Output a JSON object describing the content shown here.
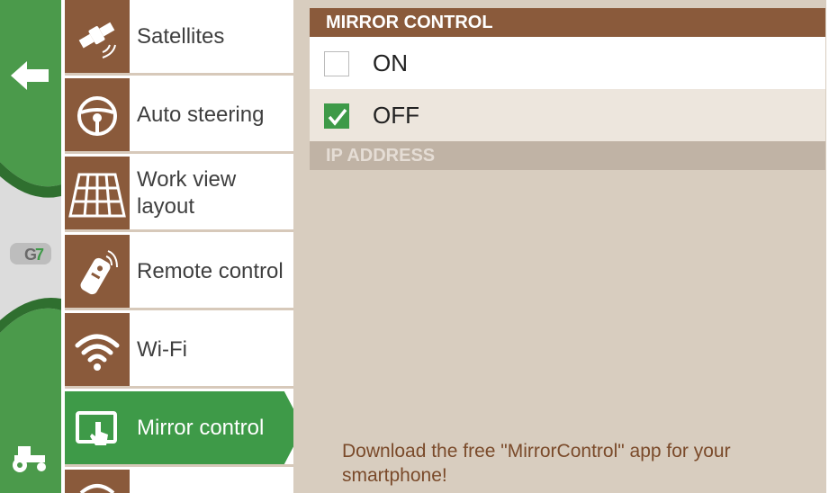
{
  "colors": {
    "rail_green": "#4b9a4b",
    "icon_brown": "#8a5a3b",
    "active_green": "#3e9a48",
    "panel_beige": "#d8cdbf",
    "note_brown": "#7a4a2a"
  },
  "rail": {
    "back_icon": "back-arrow-icon",
    "logo_text": "G7",
    "tractor_icon": "tractor-icon"
  },
  "menu": {
    "items": [
      {
        "label": "Satellites",
        "icon": "satellite-icon"
      },
      {
        "label": "Auto steering",
        "icon": "steering-wheel-icon"
      },
      {
        "label": "Work view layout",
        "icon": "grid-layout-icon"
      },
      {
        "label": "Remote control",
        "icon": "remote-control-icon"
      },
      {
        "label": "Wi-Fi",
        "icon": "wifi-icon"
      },
      {
        "label": "Mirror control",
        "icon": "tablet-touch-icon",
        "active": true
      }
    ]
  },
  "mirror": {
    "header": "MIRROR CONTROL",
    "options": [
      {
        "label": "ON",
        "checked": false
      },
      {
        "label": "OFF",
        "checked": true
      }
    ]
  },
  "ip": {
    "header": "IP ADDRESS"
  },
  "note": "Download the free \"MirrorControl\" app for your smartphone!"
}
